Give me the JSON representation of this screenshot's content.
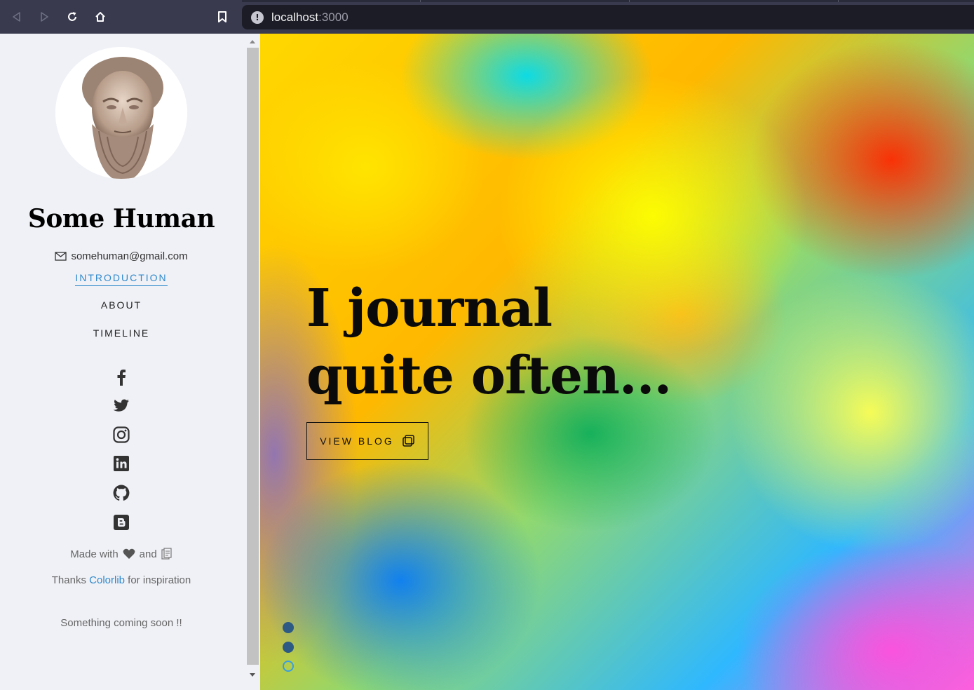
{
  "browser": {
    "url_host": "localhost",
    "url_port": ":3000",
    "back_icon": "back-arrow-icon",
    "forward_icon": "forward-arrow-icon",
    "reload_icon": "reload-icon",
    "home_icon": "home-icon",
    "bookmark_icon": "bookmark-icon"
  },
  "sidebar": {
    "name": "Some Human",
    "email": "somehuman@gmail.com",
    "nav": [
      {
        "label": "INTRODUCTION",
        "active": true
      },
      {
        "label": "ABOUT",
        "active": false
      },
      {
        "label": "TIMELINE",
        "active": false
      }
    ],
    "social": [
      "facebook-icon",
      "twitter-icon",
      "instagram-icon",
      "linkedin-icon",
      "github-icon",
      "blogger-icon"
    ],
    "made_with": "Made with",
    "and": "and",
    "thanks_prefix": "Thanks",
    "thanks_link": "Colorlib",
    "thanks_suffix": "for inspiration",
    "coming_soon": "Something coming soon !!"
  },
  "hero": {
    "title_line1": "I journal",
    "title_line2": "quite often...",
    "button_label": "VIEW BLOG",
    "slides": {
      "count": 3,
      "active_index": 2
    }
  },
  "colors": {
    "accent": "#2f89cc",
    "sidebar_bg": "#f0f1f6",
    "browser_bar": "#393a4e",
    "dot_filled": "#2c5a84",
    "dot_active_ring": "#3a9de0"
  }
}
